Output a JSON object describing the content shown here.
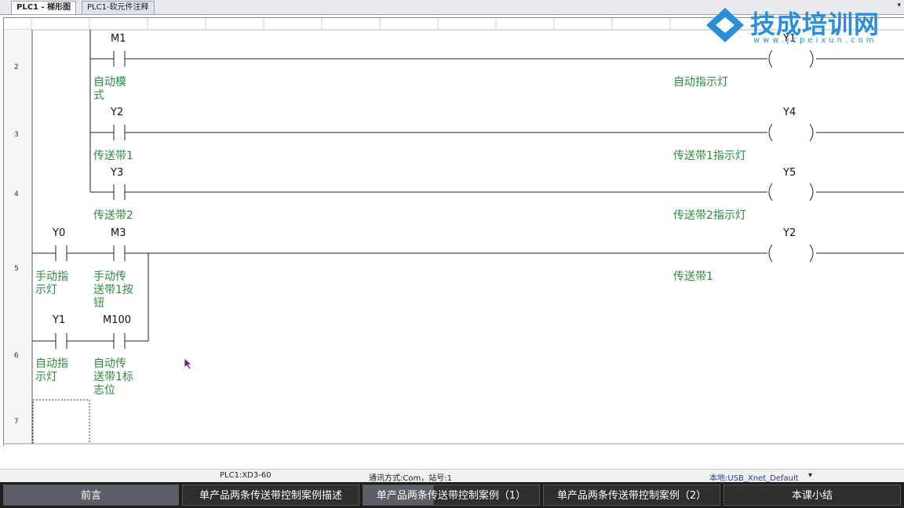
{
  "tabs": [
    {
      "label": "PLC1 - 梯形图",
      "active": true
    },
    {
      "label": "PLC1-软元件注释",
      "active": false
    }
  ],
  "logo": {
    "title": "技成培训网",
    "subtitle": "www.jcpeixun.com",
    "color": "#2a8fd6"
  },
  "rows": [
    "2",
    "3",
    "4",
    "5",
    "6",
    "7"
  ],
  "contacts": [
    {
      "id": "M1",
      "comment": "自动模\n式"
    },
    {
      "id": "Y2",
      "comment": "传送带1"
    },
    {
      "id": "Y3",
      "comment": "传送带2"
    },
    {
      "id": "Y0",
      "comment": "手动指\n示灯"
    },
    {
      "id": "M3",
      "comment": "手动传\n送带1按\n钮"
    },
    {
      "id": "Y1",
      "comment": "自动指\n示灯"
    },
    {
      "id": "M100",
      "comment": "自动传\n送带1标\n志位"
    }
  ],
  "coils": [
    {
      "id": "Y1",
      "comment": "自动指示灯"
    },
    {
      "id": "Y4",
      "comment": "传送带1指示灯"
    },
    {
      "id": "Y5",
      "comment": "传送带2指示灯"
    },
    {
      "id": "Y2",
      "comment": "传送带1"
    }
  ],
  "status": {
    "plc": "PLC1:XD3-60",
    "comm": "通讯方式:Com，站号:1",
    "link": "本地:USB_Xnet_Default"
  },
  "nav": [
    "前言",
    "单产品两条传送带控制案例描述",
    "单产品两条传送带控制案例（1）",
    "单产品两条传送带控制案例（2）",
    "本课小结"
  ],
  "colors": {
    "comment": "#2e8b3e",
    "accent": "#2a8fd6"
  }
}
